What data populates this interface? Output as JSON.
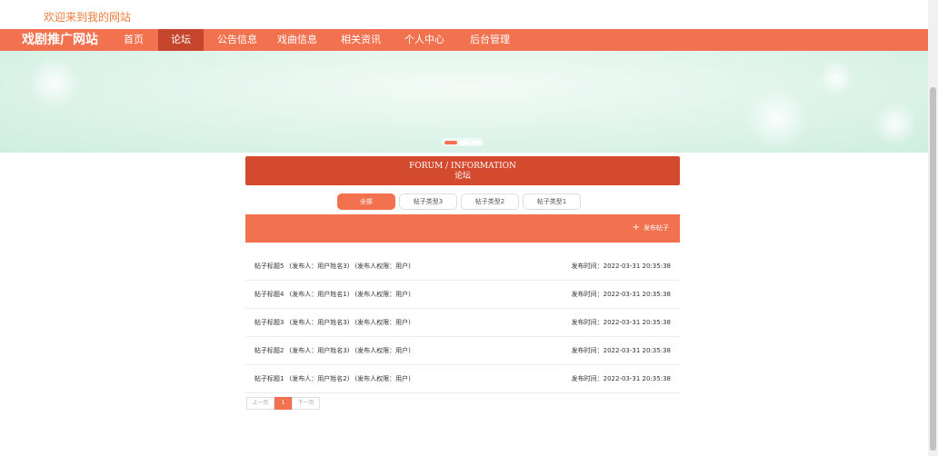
{
  "header": {
    "welcome": "欢迎来到我的网站",
    "site_title": "戏剧推广网站"
  },
  "nav": {
    "items": [
      {
        "label": "首页"
      },
      {
        "label": "论坛"
      },
      {
        "label": "公告信息"
      },
      {
        "label": "戏曲信息"
      },
      {
        "label": "相关资讯"
      },
      {
        "label": "个人中心"
      },
      {
        "label": "后台管理"
      }
    ],
    "active": "论坛"
  },
  "forum": {
    "title_en": "FORUM / INFORMATION",
    "title_cn": "论坛",
    "tabs": [
      {
        "label": "全部"
      },
      {
        "label": "帖子类型3"
      },
      {
        "label": "帖子类型2"
      },
      {
        "label": "帖子类型1"
      }
    ],
    "active_tab": "全部",
    "publish_label": "发布帖子",
    "publish_icon": "plus-icon",
    "time_label": "发布时间：",
    "posts": [
      {
        "title": "帖子标题5",
        "author": "(发布人：用户姓名3)",
        "role": "(发布人权限：用户)",
        "time": "2022-03-31 20:35:38"
      },
      {
        "title": "帖子标题4",
        "author": "(发布人：用户姓名1)",
        "role": "(发布人权限：用户)",
        "time": "2022-03-31 20:35:38"
      },
      {
        "title": "帖子标题3",
        "author": "(发布人：用户姓名3)",
        "role": "(发布人权限：用户)",
        "time": "2022-03-31 20:35:38"
      },
      {
        "title": "帖子标题2",
        "author": "(发布人：用户姓名3)",
        "role": "(发布人权限：用户)",
        "time": "2022-03-31 20:35:38"
      },
      {
        "title": "帖子标题1",
        "author": "(发布人：用户姓名2)",
        "role": "(发布人权限：用户)",
        "time": "2022-03-31 20:35:38"
      }
    ]
  },
  "pagination": {
    "prev": "上一页",
    "current": "1",
    "next": "下一页"
  },
  "colors": {
    "nav_bg": "#f2714f",
    "nav_active": "#c6452d",
    "header_bar": "#d34a2f",
    "welcome_text": "#f07c3c",
    "banner": "#d9f2e8"
  }
}
